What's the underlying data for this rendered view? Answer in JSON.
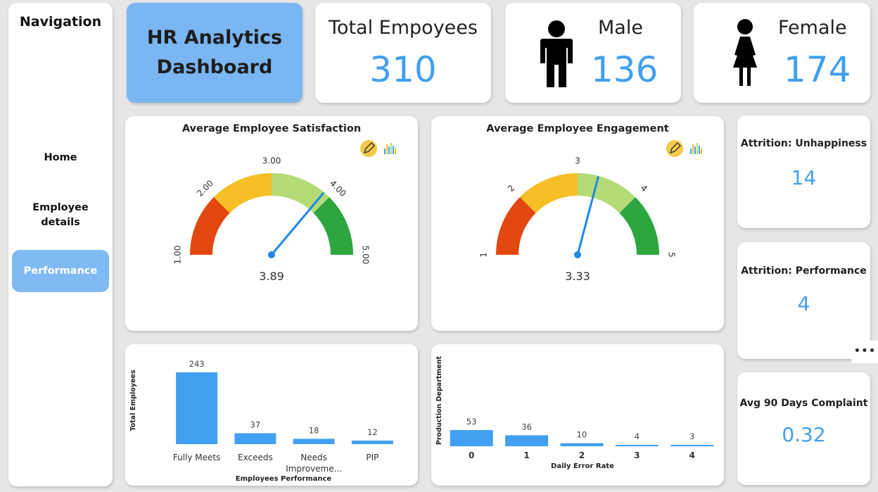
{
  "navigation": {
    "title": "Navigation",
    "items": [
      {
        "label": "Home"
      },
      {
        "label": "Employee details"
      },
      {
        "label": "Performance"
      }
    ]
  },
  "banner": {
    "title_line1": "HR Analytics",
    "title_line2": "Dashboard"
  },
  "kpis": {
    "total": {
      "label": "Total Empoyees",
      "value": "310"
    },
    "male": {
      "label": "Male",
      "value": "136"
    },
    "female": {
      "label": "Female",
      "value": "174"
    }
  },
  "colors": {
    "accent": "#42a0f0",
    "nav_active": "#7fbaf2",
    "banner": "#79b6f2",
    "bar": "#42a0f0",
    "gauge_red": "#e2470f",
    "gauge_orange": "#f6bf26",
    "gauge_lightgreen": "#b3dc76",
    "gauge_green": "#2ea63f",
    "needle": "#1e88e5"
  },
  "gauges": [
    {
      "title": "Average Employee Satisfaction",
      "min": 1,
      "max": 5,
      "value": 3.89,
      "value_label": "3.89",
      "ticks": [
        {
          "v": 1,
          "label": "1.00"
        },
        {
          "v": 2,
          "label": "2.00"
        },
        {
          "v": 3,
          "label": "3.00"
        },
        {
          "v": 4,
          "label": "4.00"
        },
        {
          "v": 5,
          "label": "5.00"
        }
      ],
      "icons": [
        "pencil-icon",
        "bar-chart-icon"
      ]
    },
    {
      "title": "Average Employee Engagement",
      "min": 1,
      "max": 5,
      "value": 3.33,
      "value_label": "3.33",
      "ticks": [
        {
          "v": 1,
          "label": "1"
        },
        {
          "v": 2,
          "label": "2"
        },
        {
          "v": 3,
          "label": "3"
        },
        {
          "v": 4,
          "label": "4"
        },
        {
          "v": 5,
          "label": "5"
        }
      ],
      "icons": [
        "pencil-icon",
        "bar-chart-icon"
      ]
    }
  ],
  "side_cards": [
    {
      "title": "Attrition: Unhappiness",
      "value": "14"
    },
    {
      "title": "Attrition: Performance",
      "value": "4"
    },
    {
      "title": "Avg 90 Days Complaint",
      "value": "0.32"
    }
  ],
  "more_options": "•••",
  "chart_data": [
    {
      "type": "bar",
      "categories": [
        "Fully Meets",
        "Exceeds",
        "Needs Improveme...",
        "PIP"
      ],
      "values": [
        243,
        37,
        18,
        12
      ],
      "xlabel": "Employees Performance",
      "ylabel": "Total Employees",
      "ylim": [
        0,
        243
      ]
    },
    {
      "type": "bar",
      "categories": [
        "0",
        "1",
        "2",
        "3",
        "4"
      ],
      "values": [
        53,
        36,
        10,
        4,
        3
      ],
      "xlabel": "Daily Error Rate",
      "ylabel": "Production Department",
      "ylim": [
        0,
        53
      ]
    }
  ]
}
